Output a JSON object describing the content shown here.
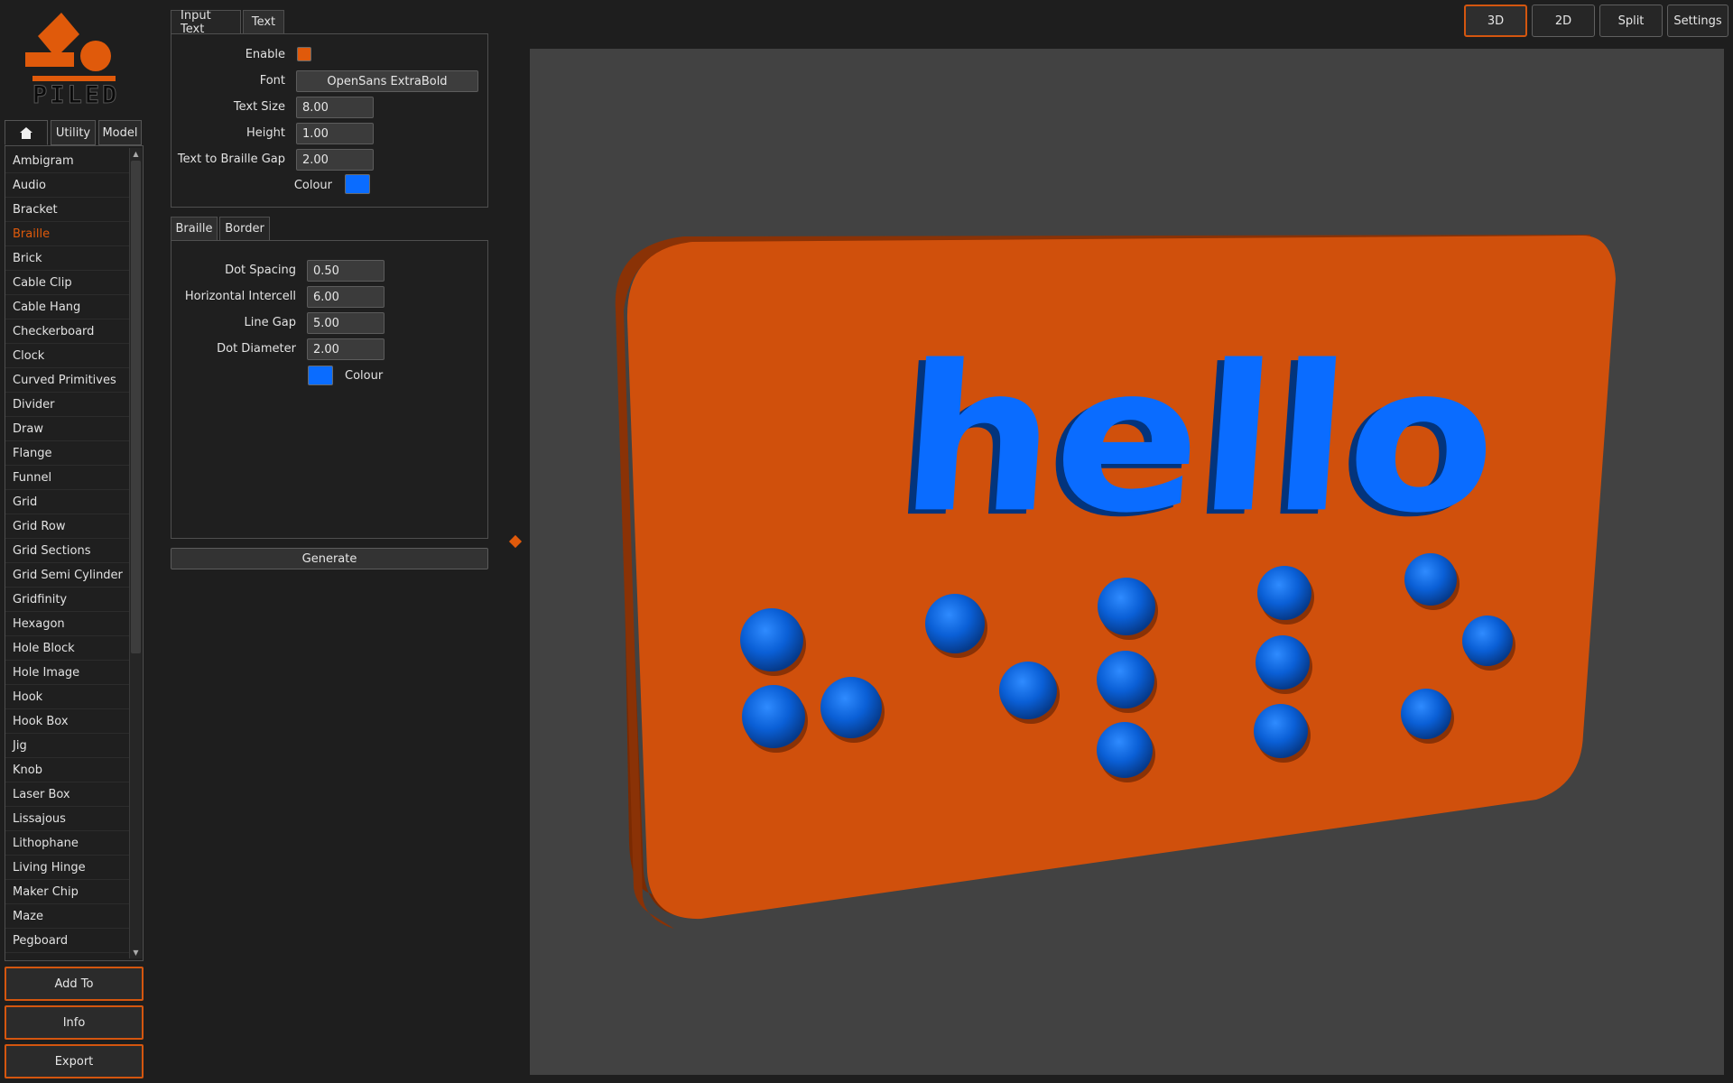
{
  "logo": {
    "text": "PILED",
    "brand_color": "#e05a0b"
  },
  "left_nav": {
    "tabs": [
      {
        "label": "",
        "icon": "home-icon"
      },
      {
        "label": "Utility"
      },
      {
        "label": "Model"
      }
    ],
    "selected_item": "Braille",
    "items": [
      "Ambigram",
      "Audio",
      "Bracket",
      "Braille",
      "Brick",
      "Cable Clip",
      "Cable Hang",
      "Checkerboard",
      "Clock",
      "Curved Primitives",
      "Divider",
      "Draw",
      "Flange",
      "Funnel",
      "Grid",
      "Grid Row",
      "Grid Sections",
      "Grid Semi Cylinder",
      "Gridfinity",
      "Hexagon",
      "Hole Block",
      "Hole Image",
      "Hook",
      "Hook Box",
      "Jig",
      "Knob",
      "Laser Box",
      "Lissajous",
      "Lithophane",
      "Living Hinge",
      "Maker Chip",
      "Maze",
      "Pegboard"
    ],
    "actions": {
      "add_to": "Add To",
      "info": "Info",
      "export": "Export"
    }
  },
  "text_panel": {
    "tabs": [
      "Input Text",
      "Text"
    ],
    "enable_label": "Enable",
    "enable_color": "#e05a0b",
    "font_label": "Font",
    "font_value": "OpenSans ExtraBold",
    "text_size_label": "Text Size",
    "text_size_value": "8.00",
    "height_label": "Height",
    "height_value": "1.00",
    "gap_label": "Text to Braille Gap",
    "gap_value": "2.00",
    "colour_label": "Colour",
    "colour": "#0a6cff"
  },
  "braille_panel": {
    "tabs": [
      "Braille",
      "Border"
    ],
    "dot_spacing_label": "Dot Spacing",
    "dot_spacing_value": "0.50",
    "intercell_label": "Horizontal Intercell",
    "intercell_value": "6.00",
    "line_gap_label": "Line Gap",
    "line_gap_value": "5.00",
    "dot_diameter_label": "Dot Diameter",
    "dot_diameter_value": "2.00",
    "colour_label": "Colour",
    "colour": "#0a6cff"
  },
  "generate_label": "Generate",
  "view_modes": {
    "active": "3D",
    "buttons": [
      "3D",
      "2D",
      "Split",
      "Settings"
    ]
  },
  "viewport": {
    "model_text": "hello",
    "plate_color": "#d0500c",
    "text_color": "#0a6cff",
    "background": "#424242"
  }
}
